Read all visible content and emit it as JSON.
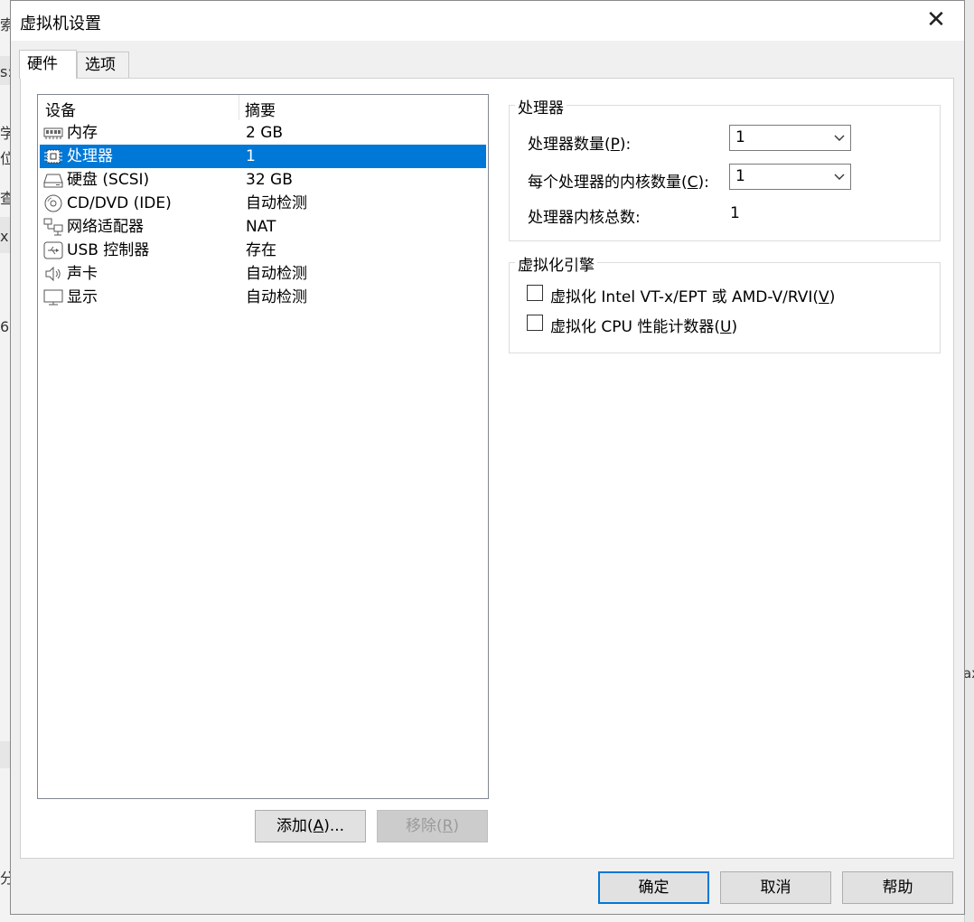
{
  "background_fragments": [
    "索",
    "s:",
    "学",
    "位",
    "查",
    "x",
    "6",
    "ax",
    "分"
  ],
  "dialog": {
    "title": "虚拟机设置",
    "close_glyph": "✕"
  },
  "tabs": [
    {
      "label": "硬件",
      "active": true
    },
    {
      "label": "选项",
      "active": false
    }
  ],
  "device_list": {
    "headers": {
      "device": "设备",
      "summary": "摘要"
    },
    "selected_index": 1,
    "items": [
      {
        "icon": "memory-icon",
        "name": "内存",
        "summary": "2 GB"
      },
      {
        "icon": "processor-icon",
        "name": "处理器",
        "summary": "1"
      },
      {
        "icon": "hard-disk-icon",
        "name": "硬盘 (SCSI)",
        "summary": "32 GB"
      },
      {
        "icon": "cd-dvd-icon",
        "name": "CD/DVD (IDE)",
        "summary": "自动检测"
      },
      {
        "icon": "network-adapter-icon",
        "name": "网络适配器",
        "summary": "NAT"
      },
      {
        "icon": "usb-icon",
        "name": "USB 控制器",
        "summary": "存在"
      },
      {
        "icon": "sound-card-icon",
        "name": "声卡",
        "summary": "自动检测"
      },
      {
        "icon": "display-icon",
        "name": "显示",
        "summary": "自动检测"
      }
    ]
  },
  "list_buttons": {
    "add": {
      "prefix": "添加(",
      "mnemonic": "A",
      "suffix": ")..."
    },
    "remove": {
      "prefix": "移除(",
      "mnemonic": "R",
      "suffix": ")",
      "disabled": true
    }
  },
  "processor_group": {
    "title": "处理器",
    "num_processors": {
      "prefix": "处理器数量(",
      "mnemonic": "P",
      "suffix": "):",
      "value": "1"
    },
    "cores_per_processor": {
      "prefix": "每个处理器的内核数量(",
      "mnemonic": "C",
      "suffix": "):",
      "value": "1"
    },
    "total_cores": {
      "label": "处理器内核总数:",
      "value": "1"
    }
  },
  "virtualization_group": {
    "title": "虚拟化引擎",
    "vtx": {
      "prefix": "虚拟化 Intel VT-x/EPT 或 AMD-V/RVI(",
      "mnemonic": "V",
      "suffix": ")",
      "checked": false
    },
    "cpu_counters": {
      "prefix": "虚拟化 CPU 性能计数器(",
      "mnemonic": "U",
      "suffix": ")",
      "checked": false
    }
  },
  "footer_buttons": {
    "ok": "确定",
    "cancel": "取消",
    "help": "帮助"
  },
  "colors": {
    "selection": "#0078d7",
    "window_bg": "#f0f0f0",
    "panel_bg": "#ffffff"
  }
}
